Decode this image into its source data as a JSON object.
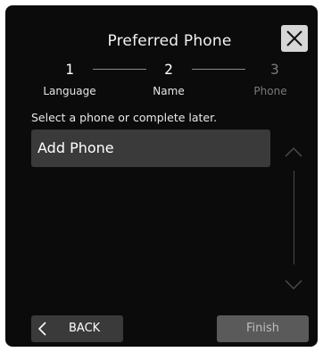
{
  "header": {
    "title": "Preferred Phone",
    "close_icon": "close-icon"
  },
  "steps": [
    {
      "number": "1",
      "label": "Language",
      "state": "done"
    },
    {
      "number": "2",
      "label": "Name",
      "state": "current"
    },
    {
      "number": "3",
      "label": "Phone",
      "state": "inactive"
    }
  ],
  "main": {
    "instruction": "Select a phone or complete later.",
    "add_phone_label": "Add Phone",
    "scroll_up_icon": "chevron-up-icon",
    "scroll_down_icon": "chevron-down-icon"
  },
  "footer": {
    "back_label": "BACK",
    "back_icon": "chevron-left-icon",
    "finish_label": "Finish"
  },
  "colors": {
    "background": "#0b0b0b",
    "button": "#3a3a3a",
    "finish_disabled": "#5a5a5a",
    "close_button": "#d6d6d6",
    "inactive_text": "#7a7a7a"
  }
}
